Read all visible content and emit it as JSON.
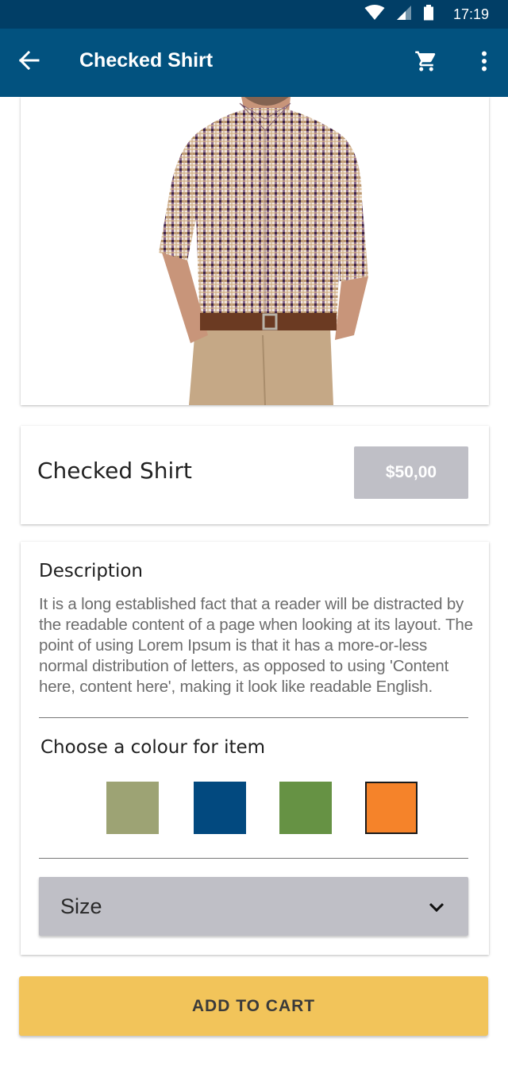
{
  "status_bar": {
    "time": "17:19",
    "icons": [
      "wifi-icon",
      "signal-icon",
      "battery-icon"
    ]
  },
  "app_bar": {
    "title": "Checked Shirt",
    "icons": [
      "arrow-back-icon",
      "shopping-cart-icon",
      "more-vert-icon"
    ]
  },
  "product": {
    "image_alt": "checked-shirt-photo",
    "name": "Checked Shirt",
    "price": "$50,00"
  },
  "description": {
    "heading": "Description",
    "text": "It is a long established fact that a reader will be distracted by the readable content of a page when looking at its layout. The point of using Lorem Ipsum is that it has a more-or-less normal distribution of letters, as opposed to using 'Content here, content here', making it look like readable English."
  },
  "colour": {
    "heading": "Choose a colour for item",
    "options": [
      {
        "name": "olive",
        "color": "#9da374"
      },
      {
        "name": "navy",
        "color": "#02497f"
      },
      {
        "name": "green",
        "color": "#669244"
      },
      {
        "name": "orange",
        "color": "#f5832a"
      }
    ],
    "selected": "orange"
  },
  "size": {
    "label": "Size"
  },
  "add_to_cart": {
    "label": "ADD TO CART"
  },
  "colors": {
    "status_bar": "#013e66",
    "app_bar": "#02527f",
    "price_button": "#bfbfc6",
    "add_to_cart": "#f2c45a"
  }
}
